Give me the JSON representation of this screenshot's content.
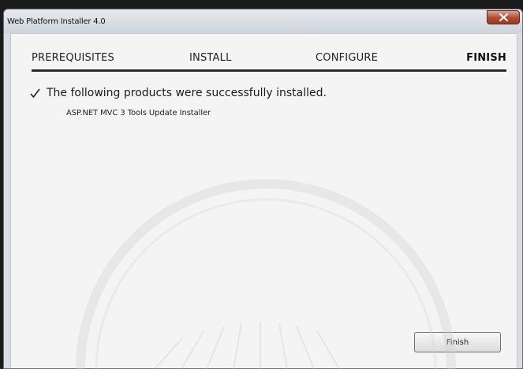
{
  "window": {
    "title": "Web Platform Installer 4.0"
  },
  "steps": [
    {
      "label": "PREREQUISITES",
      "active": false
    },
    {
      "label": "INSTALL",
      "active": false
    },
    {
      "label": "CONFIGURE",
      "active": false
    },
    {
      "label": "FINISH",
      "active": true
    }
  ],
  "result": {
    "message": "The following products were successfully installed.",
    "products": [
      "ASP.NET MVC 3 Tools Update Installer"
    ]
  },
  "buttons": {
    "finish_label": "Finish"
  },
  "colors": {
    "close_button": "#b14a33",
    "step_rule": "#2b2b2b",
    "content_background": "#f4f4f4"
  },
  "icons": {
    "close": "close-icon",
    "check": "checkmark-icon"
  }
}
